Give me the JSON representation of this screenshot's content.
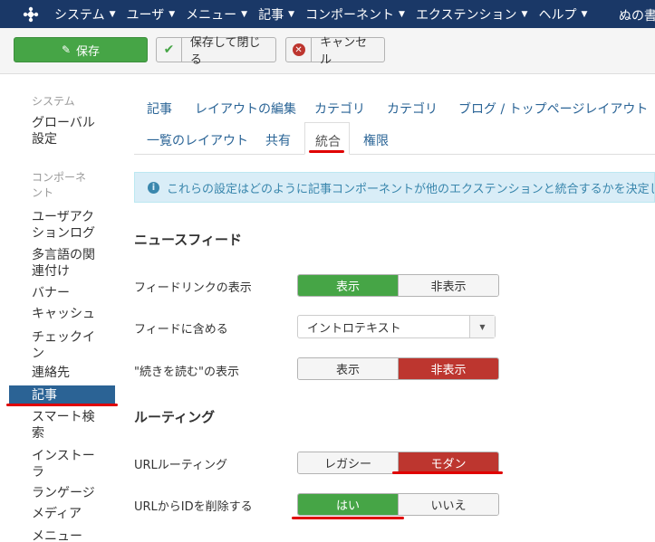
{
  "navbar": {
    "menu": [
      {
        "label": "システム"
      },
      {
        "label": "ユーザ"
      },
      {
        "label": "メニュー"
      },
      {
        "label": "記事"
      },
      {
        "label": "コンポーネント"
      },
      {
        "label": "エクステンション"
      },
      {
        "label": "ヘルプ"
      }
    ],
    "user_label": "ぬの書"
  },
  "toolbar": {
    "save_label": "保存",
    "save_close_label": "保存して閉じる",
    "cancel_label": "キャンセル"
  },
  "sidebar": {
    "system_header": "システム",
    "global_config": "グローバル設定",
    "components_header": "コンポーネント",
    "items": [
      {
        "label": "ユーザアクションログ"
      },
      {
        "label": "多言語の関連付け"
      },
      {
        "label": "バナー"
      },
      {
        "label": "キャッシュ"
      },
      {
        "label": "チェックイン"
      },
      {
        "label": "連絡先"
      },
      {
        "label": "記事"
      },
      {
        "label": "スマート検索"
      },
      {
        "label": "インストーラ"
      },
      {
        "label": "ランゲージ"
      },
      {
        "label": "メディア"
      },
      {
        "label": "メニュー"
      }
    ],
    "active_index": 6
  },
  "tabs": {
    "row1": [
      "記事",
      "レイアウトの編集",
      "カテゴリ",
      "カテゴリ",
      "ブログ / トップページレイアウト"
    ],
    "row2": [
      "一覧のレイアウト",
      "共有",
      "統合",
      "権限"
    ],
    "active": "統合"
  },
  "alert": {
    "text": "これらの設定はどのように記事コンポーネントが他のエクステンションと統合するかを決定し"
  },
  "form": {
    "newsfeed_title": "ニュースフィード",
    "feed_link": {
      "label": "フィードリンクの表示",
      "options": [
        "表示",
        "非表示"
      ],
      "selected": "表示"
    },
    "feed_include": {
      "label": "フィードに含める",
      "value": "イントロテキスト"
    },
    "read_more": {
      "label": "\"続きを読む\"の表示",
      "options": [
        "表示",
        "非表示"
      ],
      "selected": "非表示"
    },
    "routing_title": "ルーティング",
    "url_routing": {
      "label": "URLルーティング",
      "options": [
        "レガシー",
        "モダン"
      ],
      "selected": "モダン"
    },
    "remove_id": {
      "label": "URLからIDを削除する",
      "options": [
        "はい",
        "いいえ"
      ],
      "selected": "はい"
    }
  },
  "colors": {
    "navbar": "#1a3867",
    "success": "#46a546",
    "danger": "#bd362f",
    "sidebar_active": "#2b6395",
    "annotation": "#e00000"
  }
}
